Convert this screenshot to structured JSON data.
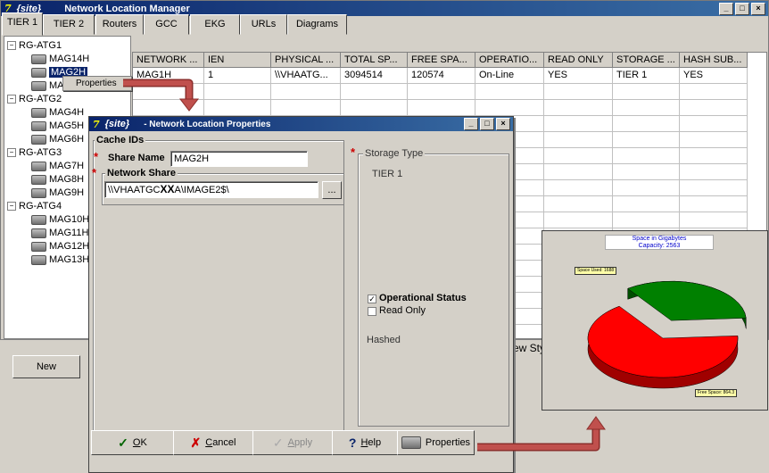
{
  "main_window": {
    "logo": "7",
    "site": "{site}",
    "title": "Network Location Manager",
    "tabs": [
      "TIER 1",
      "TIER 2",
      "Routers",
      "GCC",
      "EKG",
      "URLs",
      "Diagrams"
    ],
    "tree": [
      {
        "label": "RG-ATG1",
        "type": "group"
      },
      {
        "label": "MAG14H",
        "type": "node"
      },
      {
        "label": "MAG2H",
        "type": "node",
        "selected": true
      },
      {
        "label": "MAG",
        "type": "node"
      },
      {
        "label": "RG-ATG2",
        "type": "group"
      },
      {
        "label": "MAG4H",
        "type": "node"
      },
      {
        "label": "MAG5H",
        "type": "node"
      },
      {
        "label": "MAG6H",
        "type": "node"
      },
      {
        "label": "RG-ATG3",
        "type": "group"
      },
      {
        "label": "MAG7H",
        "type": "node"
      },
      {
        "label": "MAG8H",
        "type": "node"
      },
      {
        "label": "MAG9H",
        "type": "node"
      },
      {
        "label": "RG-ATG4",
        "type": "group"
      },
      {
        "label": "MAG10H",
        "type": "node"
      },
      {
        "label": "MAG11H",
        "type": "node"
      },
      {
        "label": "MAG12H",
        "type": "node"
      },
      {
        "label": "MAG13H",
        "type": "node"
      }
    ],
    "context_menu_item": "Properties",
    "grid": {
      "columns": [
        "NETWORK ...",
        "IEN",
        "PHYSICAL ...",
        "TOTAL SP...",
        "FREE SPA...",
        "OPERATIO...",
        "READ ONLY",
        "STORAGE ...",
        "HASH SUB..."
      ],
      "rows": [
        [
          "MAG1H",
          "1",
          "\\\\VHAATG...",
          "3094514",
          "120574",
          "On-Line",
          "YES",
          "TIER 1",
          "YES"
        ]
      ]
    },
    "new_button": "New",
    "partial_text": "ew Sty"
  },
  "dialog": {
    "logo": "7",
    "site": "{site}",
    "title": "- Network Location Properties",
    "cache_ids_label": "Cache IDs",
    "required_marker": "*",
    "share_name_label": "Share Name",
    "share_name_value": "MAG2H",
    "network_share_label": "Network Share",
    "network_share_value": "\\\\VHAATGC",
    "network_share_mark": "XX",
    "network_share_tail": "A\\IMAGE2$\\",
    "browse_button": "...",
    "storage_type_label": "Storage Type",
    "storage_type_value": "TIER 1",
    "operational_status_label": "Operational Status",
    "operational_status_checked": true,
    "read_only_label": "Read Only",
    "read_only_checked": false,
    "hashed_label": "Hashed",
    "buttons": {
      "ok": {
        "mnemonic": "O",
        "rest": "K"
      },
      "cancel": {
        "mnemonic": "C",
        "rest": "ancel"
      },
      "apply": {
        "mnemonic": "A",
        "rest": "pply"
      },
      "help": {
        "mnemonic": "H",
        "rest": "elp"
      },
      "properties": "Properties"
    },
    "check_glyph": "✓",
    "cross_glyph": "✗",
    "question_glyph": "?"
  },
  "chart_data": {
    "type": "pie",
    "title": "Space in Gigabytes",
    "subtitle": "Capacity: 2563",
    "slices": [
      {
        "label": "Space Used: 1688",
        "value": 1688,
        "color": "#ff0000"
      },
      {
        "label": "Free Space: 864.3",
        "value": 864.3,
        "color": "#008000"
      }
    ]
  },
  "colors": {
    "callout_arrow": "#c0504d",
    "titlebar": "#0a246a",
    "used": "#ff0000",
    "free": "#008000"
  }
}
